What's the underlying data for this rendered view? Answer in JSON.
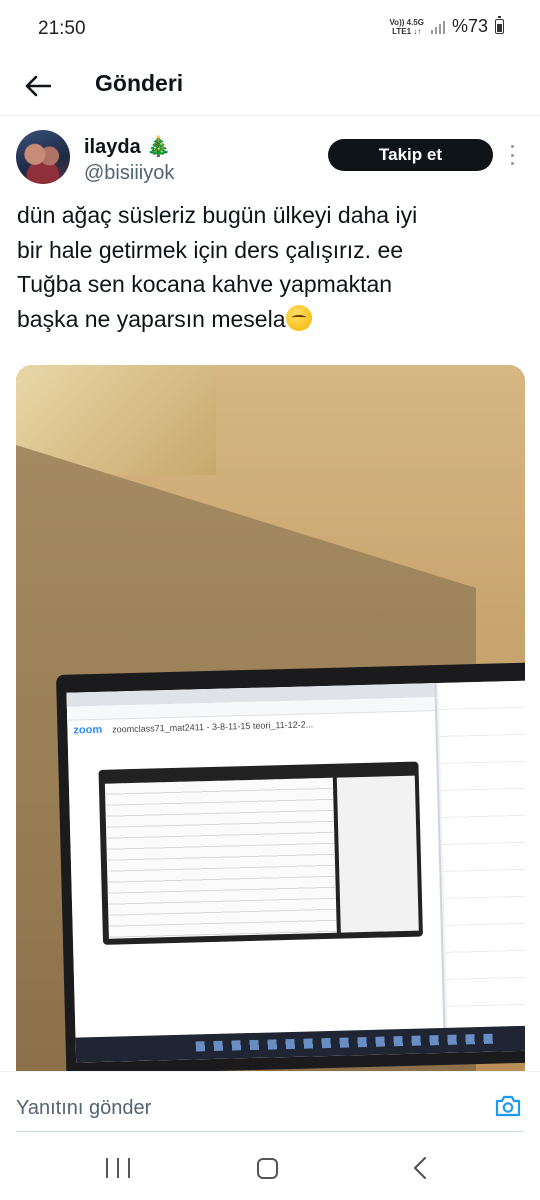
{
  "status_bar": {
    "time": "21:50",
    "network_top": "Vo)) 4.5G",
    "network_bottom": "LTE1 ↓↑",
    "battery": "%73"
  },
  "header": {
    "title": "Gönderi"
  },
  "tweet": {
    "display_name": "ilayda 🎄",
    "handle": "@bisiiiyok",
    "follow_label": "Takip et",
    "text": "dün ağaç süsleriz bugün ülkeyi daha iyi\nbir hale getirmek için ders çalışırız. ee\nTuğba sen kocana kahve yapmaktan\nbaşka ne yaparsın mesela",
    "emoji": "face-with-hand-over-mouth",
    "photo": {
      "zoom_label": "zoom",
      "zoom_meeting_title": "zoomclass71_mat2411 - 3-8-11-15 teori_11-12-2..."
    }
  },
  "reply": {
    "placeholder": "Yanıtını gönder"
  },
  "icons": {
    "back": "arrow-left-icon",
    "more": "more-vertical-icon",
    "camera": "camera-icon"
  },
  "colors": {
    "follow_button_bg": "#0f1419",
    "accent": "#1d9bf0",
    "secondary_text": "#536471"
  }
}
